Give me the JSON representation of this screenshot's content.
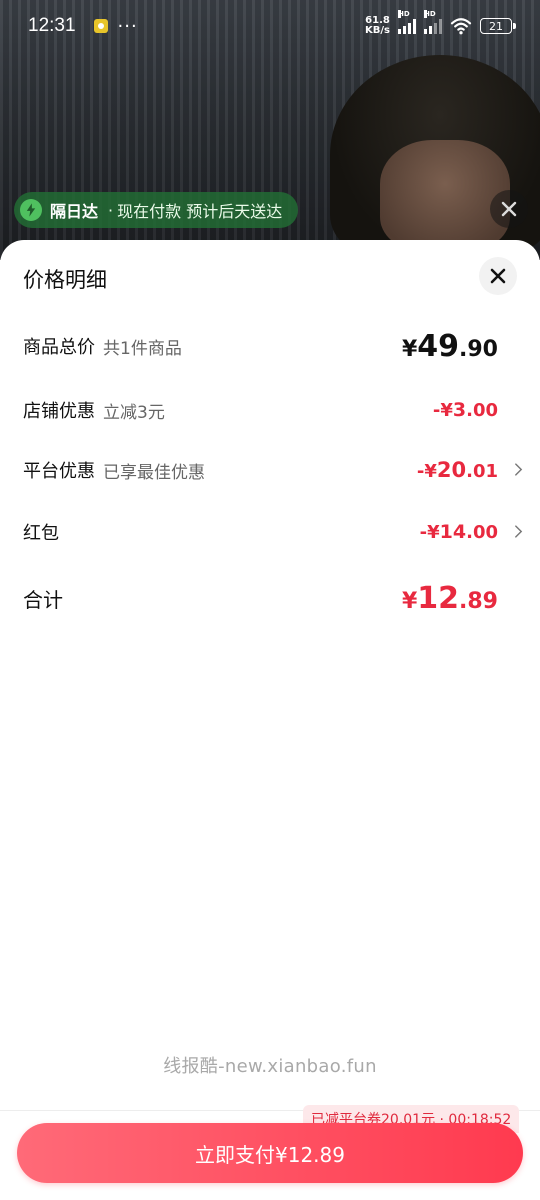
{
  "status_bar": {
    "time": "12:31",
    "dots": "···",
    "net_speed_value": "61.8",
    "net_speed_unit": "KB/s",
    "hd": "HD",
    "battery": "21"
  },
  "delivery": {
    "brand": "隔日达",
    "sep": "·",
    "text": "现在付款 预计后天送达",
    "color": "#226e34"
  },
  "sheet": {
    "title": "价格明细"
  },
  "rows": [
    {
      "label": "商品总价",
      "sub": "共1件商品",
      "prefix": "¥",
      "int": "49",
      "dec": ".90",
      "tone": "black",
      "chevron": false
    },
    {
      "label": "店铺优惠",
      "sub": "立减3元",
      "prefix": "-¥",
      "int": "3",
      "dec": ".00",
      "tone": "red",
      "chevron": false
    },
    {
      "label": "平台优惠",
      "sub": "已享最佳优惠",
      "prefix": "-¥",
      "int": "20",
      "dec": ".01",
      "tone": "red",
      "chevron": true
    },
    {
      "label": "红包",
      "sub": "",
      "prefix": "-¥",
      "int": "14",
      "dec": ".00",
      "tone": "red",
      "chevron": true
    }
  ],
  "total": {
    "label": "合计",
    "prefix": "¥",
    "int": "12",
    "dec": ".89"
  },
  "watermark": "线报酷-new.xianbao.fun",
  "footer": {
    "coupon_tag": "已减平台券20.01元 · 00:18:52",
    "pay_button": "立即支付¥12.89"
  },
  "colors": {
    "accent_red": "#e8293f",
    "pay_gradient_start": "#ff6a78",
    "pay_gradient_end": "#ff3a4f"
  }
}
